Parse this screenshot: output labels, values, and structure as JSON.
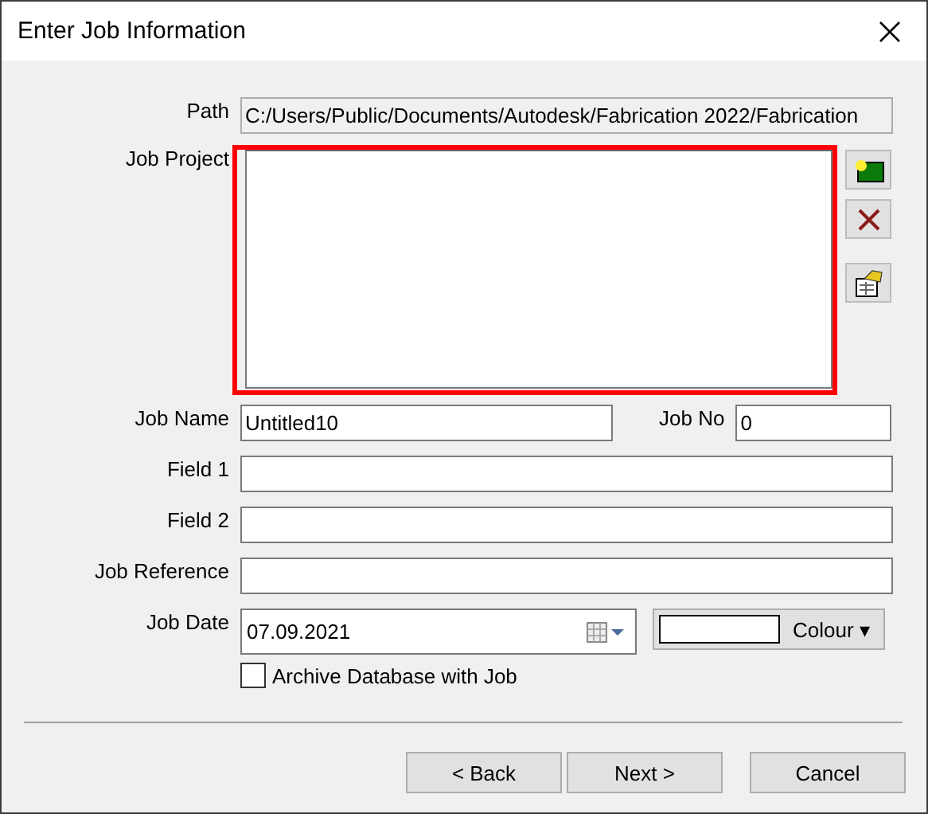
{
  "window": {
    "title": "Enter Job Information"
  },
  "path": {
    "label": "Path",
    "value": "C:/Users/Public/Documents/Autodesk/Fabrication 2022/Fabrication"
  },
  "job_project": {
    "label": "Job Project"
  },
  "job_name": {
    "label": "Job Name",
    "value": "Untitled10"
  },
  "job_no": {
    "label": "Job No",
    "value": "0"
  },
  "field_1": {
    "label": "Field 1"
  },
  "field_2": {
    "label": "Field 2"
  },
  "job_reference": {
    "label": "Job Reference"
  },
  "job_date": {
    "label": "Job Date",
    "value": "07.09.2021"
  },
  "colour": {
    "label": "Colour ▾",
    "color": "#ffffff"
  },
  "archive": {
    "label": "Archive Database with Job",
    "checked": false
  },
  "buttons": [
    "< Back",
    "Next >",
    "Cancel"
  ]
}
